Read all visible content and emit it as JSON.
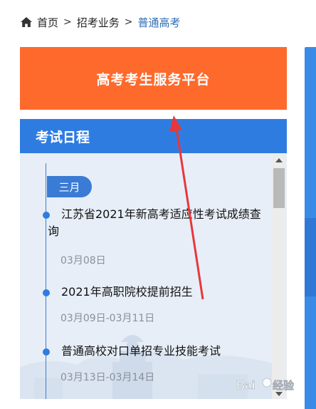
{
  "breadcrumb": {
    "home": "首页",
    "separator": ">",
    "section": "招考业务",
    "current": "普通高考"
  },
  "banner": {
    "title": "高考考生服务平台"
  },
  "schedule": {
    "title": "考试日程",
    "month": "三月",
    "events": [
      {
        "title": "江苏省2021年新高考适应性考试成绩查询",
        "date": "03月08日"
      },
      {
        "title": "2021年高职院校提前招生",
        "date": "03月09日-03月11日"
      },
      {
        "title": "普通高校对口单招专业技能考试",
        "date": "03月13日-03月14日"
      }
    ]
  },
  "colors": {
    "banner": "#fe6a2c",
    "header_blue": "#2f7ce1",
    "panel_bg": "#e7eef7",
    "current_link": "#2f6db5",
    "annotation_red": "#e8373a"
  },
  "icons": {
    "home": "home-icon"
  },
  "watermark": "Baidu经验"
}
